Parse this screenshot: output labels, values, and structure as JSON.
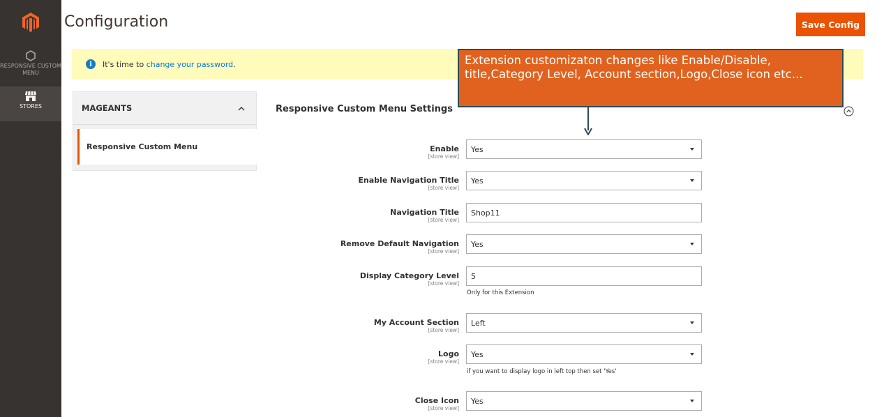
{
  "nav": {
    "items": [
      {
        "label": "RESPONSIVE CUSTOM MENU",
        "icon": "hexagon-icon"
      },
      {
        "label": "STORES",
        "icon": "store-icon"
      }
    ]
  },
  "header": {
    "title": "Configuration",
    "save_label": "Save Config"
  },
  "notice": {
    "prefix": "It's time to ",
    "link": "change your password",
    "suffix": "."
  },
  "tabs": {
    "group": "MAGEANTS",
    "item": "Responsive Custom Menu"
  },
  "section": {
    "title": "Responsive Custom Menu Settings"
  },
  "scope": "[store view]",
  "fields": [
    {
      "label": "Enable",
      "value": "Yes",
      "type": "select"
    },
    {
      "label": "Enable Navigation Title",
      "value": "Yes",
      "type": "select"
    },
    {
      "label": "Navigation Title",
      "value": "Shop11",
      "type": "text"
    },
    {
      "label": "Remove Default Navigation",
      "value": "Yes",
      "type": "select"
    },
    {
      "label": "Display Category Level",
      "value": "5",
      "type": "text",
      "note": "Only for this Extension"
    },
    {
      "label": "My Account Section",
      "value": "Left",
      "type": "select"
    },
    {
      "label": "Logo",
      "value": "Yes",
      "type": "select",
      "note": "if you want to display logo in left top then set 'Yes'"
    },
    {
      "label": "Close Icon",
      "value": "Yes",
      "type": "select"
    }
  ],
  "callout": {
    "text": "Extension customizaton changes like Enable/Disable, title,Category Level, Account section,Logo,Close icon etc..."
  },
  "colors": {
    "accent": "#eb5202",
    "sidebar": "#373330",
    "notice_bg": "#fffbbb",
    "callout_bg": "#e0621e"
  }
}
